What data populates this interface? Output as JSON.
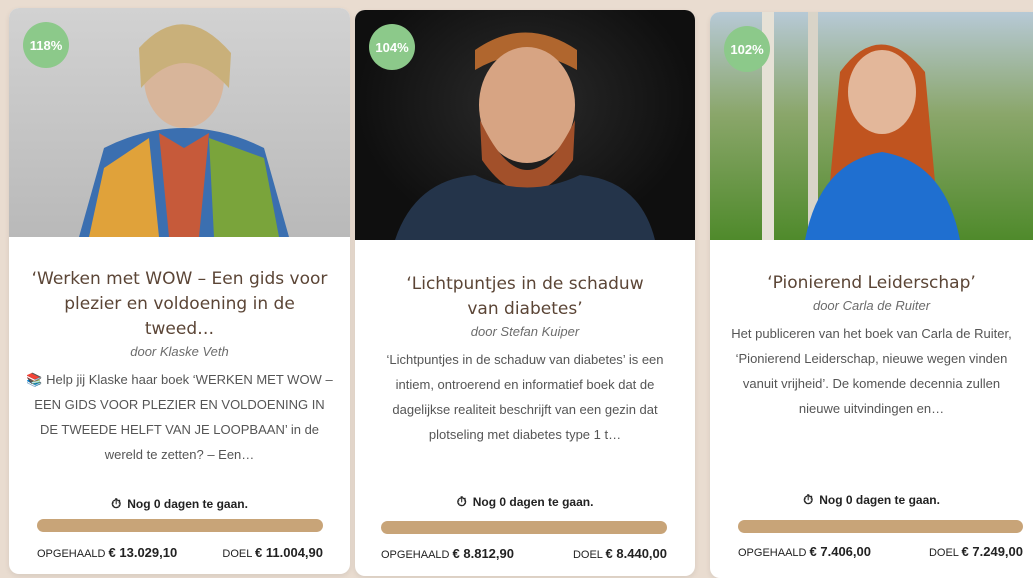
{
  "cards": [
    {
      "badge": "118%",
      "title": "‘Werken met WOW – Een gids voor plezier en voldoening in de tweed…",
      "author": "door Klaske Veth",
      "description": "📚 Help jij Klaske haar boek ‘WERKEN MET WOW – EEN GIDS VOOR PLEZIER EN VOLDOENING IN DE TWEEDE HELFT VAN JE LOOPBAAN’ in de wereld te zetten? – Een…",
      "countdown": "Nog 0 dagen te gaan.",
      "progress": 100,
      "raised_label": "OPGEHAALD",
      "raised_value": "€ 13.029,10",
      "goal_label": "DOEL",
      "goal_value": "€ 11.004,90"
    },
    {
      "badge": "104%",
      "title": "‘Lichtpuntjes in de schaduw van diabetes’",
      "author": "door Stefan Kuiper",
      "description": "‘Lichtpuntjes in de schaduw van diabetes’ is een intiem, ontroerend en informatief boek dat de dagelijkse realiteit beschrijft van een gezin dat plotseling met diabetes type 1 t…",
      "countdown": "Nog 0 dagen te gaan.",
      "progress": 100,
      "raised_label": "OPGEHAALD",
      "raised_value": "€ 8.812,90",
      "goal_label": "DOEL",
      "goal_value": "€ 8.440,00"
    },
    {
      "badge": "102%",
      "title": "‘Pionierend Leiderschap’",
      "author": "door Carla de Ruiter",
      "description": "Het publiceren van het boek van Carla de Ruiter, ‘Pionierend Leiderschap, nieuwe wegen vinden vanuit vrijheid’. De komende decennia zullen nieuwe uitvindingen en…",
      "countdown": "Nog 0 dagen te gaan.",
      "progress": 100,
      "raised_label": "OPGEHAALD",
      "raised_value": "€ 7.406,00",
      "goal_label": "DOEL",
      "goal_value": "€ 7.249,00"
    }
  ],
  "icons": {
    "countdown": "stopwatch-icon"
  },
  "colors": {
    "badge": "#8cc98a",
    "progress_bar": "#c8a478",
    "title": "#5b4536"
  }
}
